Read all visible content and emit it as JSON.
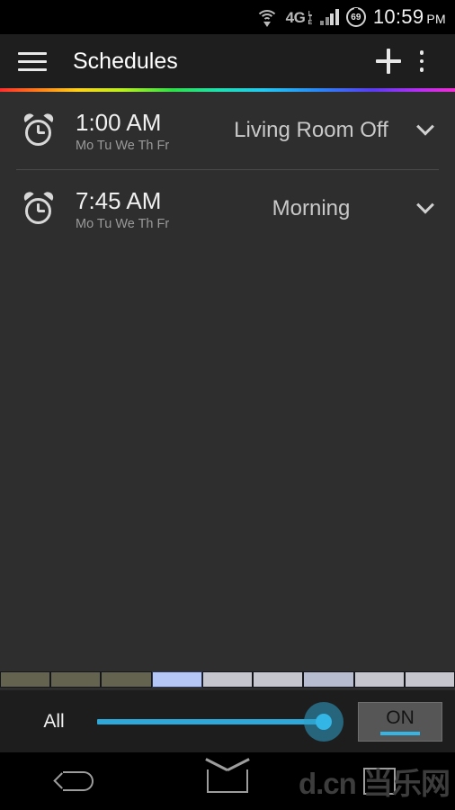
{
  "statusbar": {
    "wifi_icon": "wifi-icon",
    "network_label": "4G",
    "network_sub": "LTE",
    "signal_icon": "signal-bars-icon",
    "battery_level": "69",
    "time": "10:59",
    "am_pm": "PM"
  },
  "actionbar": {
    "menu_icon": "hamburger-menu-icon",
    "title": "Schedules",
    "add_icon": "plus-icon",
    "overflow_icon": "overflow-menu-icon"
  },
  "schedules": [
    {
      "icon": "alarm-clock-icon",
      "time": "1:00 AM",
      "days": "Mo Tu We Th Fr",
      "label": "Living Room Off",
      "expand_icon": "chevron-down-icon"
    },
    {
      "icon": "alarm-clock-icon",
      "time": "7:45 AM",
      "days": "Mo Tu We Th Fr",
      "label": "Morning",
      "expand_icon": "chevron-down-icon"
    }
  ],
  "palette": {
    "swatches": [
      {
        "color": "#636350"
      },
      {
        "color": "#636350"
      },
      {
        "color": "#636350"
      },
      {
        "color": "#b4c7f7"
      },
      {
        "color": "#c6c6ce"
      },
      {
        "color": "#c6c6ce"
      },
      {
        "color": "#b8bcd0"
      },
      {
        "color": "#c6c6ce"
      },
      {
        "color": "#c6c6ce"
      }
    ],
    "selected_index": 3
  },
  "controlbar": {
    "group_label": "All",
    "slider_name": "brightness-slider",
    "slider_value": 100,
    "slider_min": 0,
    "slider_max": 100,
    "accent_color": "#33b5e5",
    "power_label": "ON",
    "power_state": "on"
  },
  "navbar": {
    "back_icon": "back-icon",
    "home_icon": "home-icon",
    "recents_icon": "recents-icon",
    "watermark": "d.cn 当乐网"
  }
}
